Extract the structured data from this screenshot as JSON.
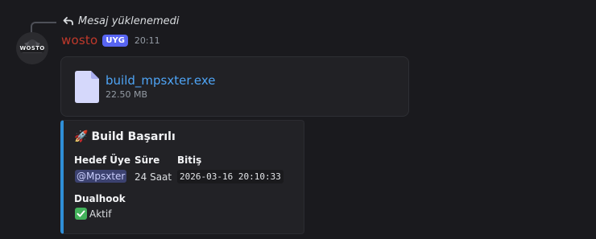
{
  "reply": {
    "text": "Mesaj yüklenemedi",
    "icon": "reply-icon"
  },
  "message": {
    "author": "wosto",
    "author_color": "#c0392b",
    "tag": "UYG",
    "timestamp": "20:11",
    "avatar_text": "WOSTO"
  },
  "attachment": {
    "icon": "file-icon",
    "file_name": "build_mpsxter.exe",
    "file_size": "22.50 MB"
  },
  "embed": {
    "accent_color": "#2f8fd8",
    "title_emoji": "🚀",
    "title": "Build Başarılı",
    "fields": [
      {
        "name": "Hedef Üye",
        "value": "@Mpsxter"
      },
      {
        "name": "Süre",
        "value": "24 Saat"
      },
      {
        "name": "Bitiş",
        "value": "2026-03-16 20:10:33"
      },
      {
        "name": "Dualhook",
        "value": "Aktif",
        "icon": "check-mark-icon"
      }
    ]
  }
}
